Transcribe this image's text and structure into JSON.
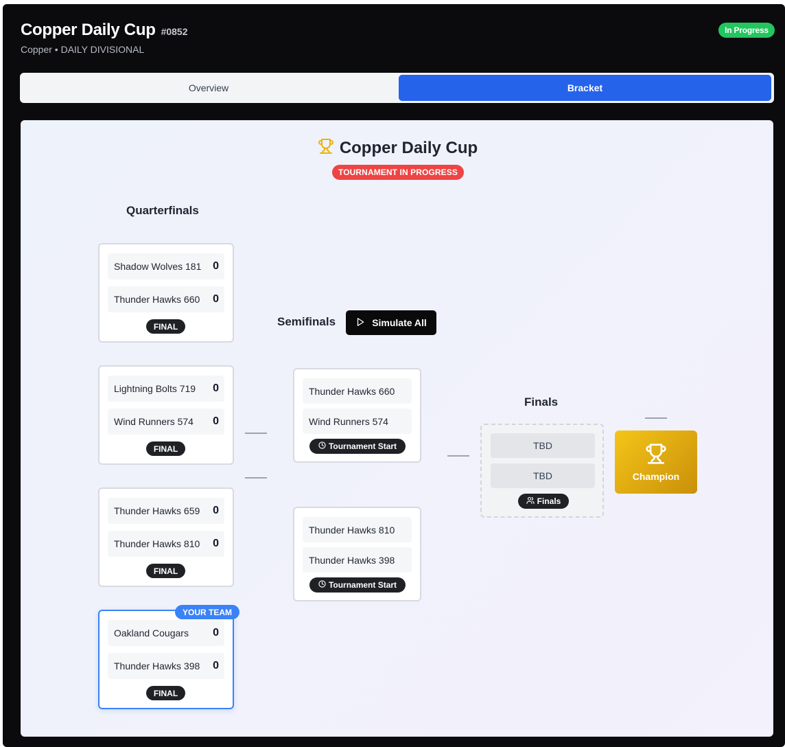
{
  "header": {
    "title": "Copper Daily Cup",
    "id": "#0852",
    "subtitle": "Copper • DAILY DIVISIONAL",
    "status": "In Progress"
  },
  "tabs": [
    {
      "label": "Overview",
      "active": false
    },
    {
      "label": "Bracket",
      "active": true
    }
  ],
  "bracket": {
    "title": "Copper Daily Cup",
    "status_badge": "TOURNAMENT IN PROGRESS",
    "quarterfinals_label": "Quarterfinals",
    "semifinals_label": "Semifinals",
    "finals_label": "Finals",
    "simulate_label": "Simulate All",
    "quarterfinals": [
      {
        "team1": "Shadow Wolves 181",
        "score1": "0",
        "team2": "Thunder Hawks 660",
        "score2": "0",
        "status": "FINAL",
        "your_team": false
      },
      {
        "team1": "Lightning Bolts 719",
        "score1": "0",
        "team2": "Wind Runners 574",
        "score2": "0",
        "status": "FINAL",
        "your_team": false
      },
      {
        "team1": "Thunder Hawks 659",
        "score1": "0",
        "team2": "Thunder Hawks 810",
        "score2": "0",
        "status": "FINAL",
        "your_team": false
      },
      {
        "team1": "Oakland Cougars",
        "score1": "0",
        "team2": "Thunder Hawks 398",
        "score2": "0",
        "status": "FINAL",
        "your_team": true,
        "your_team_label": "YOUR TEAM"
      }
    ],
    "semifinals": [
      {
        "team1": "Thunder Hawks 660",
        "team2": "Wind Runners 574",
        "status": "Tournament Start"
      },
      {
        "team1": "Thunder Hawks 810",
        "team2": "Thunder Hawks 398",
        "status": "Tournament Start"
      }
    ],
    "finals": {
      "team1": "TBD",
      "team2": "TBD",
      "status": "Finals"
    },
    "champion_label": "Champion"
  },
  "colors": {
    "accent": "#2563eb",
    "in_progress": "#22c55e",
    "tournament_badge": "#ef4444",
    "your_team": "#3b82f6",
    "champion_gold": "#f5c518"
  }
}
